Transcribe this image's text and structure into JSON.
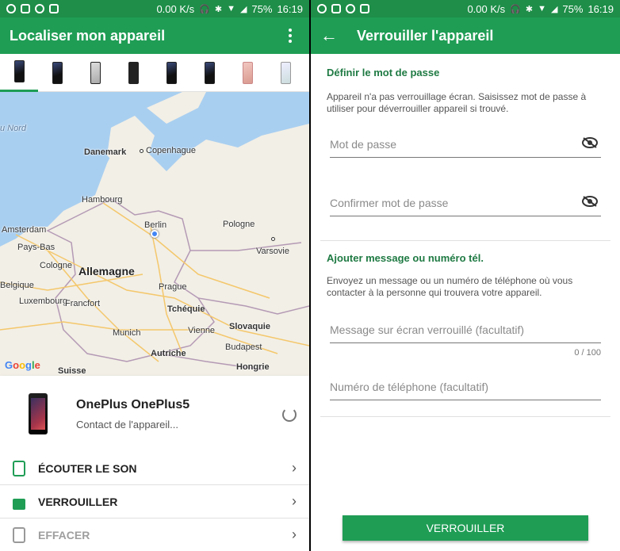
{
  "status_bar": {
    "speed": "0.00 K/s",
    "battery": "75%",
    "time": "16:19"
  },
  "left": {
    "title": "Localiser mon appareil",
    "map": {
      "labels": {
        "danemark": "Danemark",
        "copenhague": "Copenhague",
        "hambourg": "Hambourg",
        "berlin": "Berlin",
        "pologne": "Pologne",
        "amsterdam": "Amsterdam",
        "pays_bas": "Pays-Bas",
        "varsovie": "Varsovie",
        "cologne": "Cologne",
        "allemagne": "Allemagne",
        "belgique": "Belgique",
        "prague": "Prague",
        "luxembourg": "Luxembourg",
        "francfort": "Francfort",
        "tchequie": "Tchéquie",
        "munich": "Munich",
        "vienne": "Vienne",
        "slovaquie": "Slovaquie",
        "autriche": "Autriche",
        "budapest": "Budapest",
        "suisse": "Suisse",
        "hongrie": "Hongrie",
        "nord": "u Nord"
      },
      "attribution": "Google"
    },
    "device": {
      "name": "OnePlus OnePlus5",
      "status": "Contact de l'appareil..."
    },
    "actions": [
      {
        "label": "ÉCOUTER LE SON",
        "icon": "phone-ring-icon"
      },
      {
        "label": "VERROUILLER",
        "icon": "lock-icon"
      },
      {
        "label": "EFFACER",
        "icon": "erase-icon"
      }
    ]
  },
  "right": {
    "title": "Verrouiller l'appareil",
    "password_section": {
      "title": "Définir le mot de passe",
      "desc": "Appareil n'a pas verrouillage écran. Saisissez mot de passe à utiliser pour déverrouiller appareil si trouvé.",
      "password_placeholder": "Mot de passe",
      "confirm_placeholder": "Confirmer mot de passe"
    },
    "message_section": {
      "title": "Ajouter message ou numéro tél.",
      "desc": "Envoyez un message ou un numéro de téléphone où vous contacter à la personne qui trouvera votre appareil.",
      "message_placeholder": "Message sur écran verrouillé (facultatif)",
      "counter": "0 / 100",
      "phone_placeholder": "Numéro de téléphone (facultatif)"
    },
    "submit_label": "VERROUILLER"
  },
  "colors": {
    "primary": "#1f9d55",
    "status_bar": "#1e8e48",
    "section_title": "#1f7a43"
  }
}
